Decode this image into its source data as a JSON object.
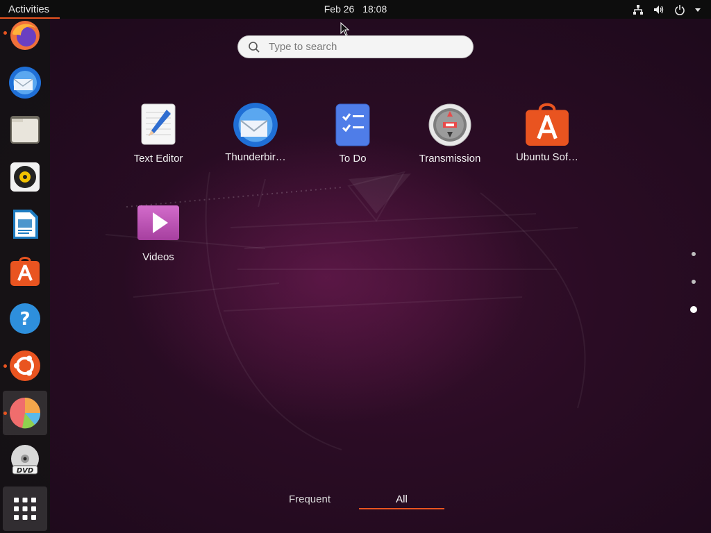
{
  "topbar": {
    "activities_label": "Activities",
    "date": "Feb 26",
    "time": "18:08",
    "tray_icons": [
      "network-icon",
      "volume-icon",
      "power-icon"
    ]
  },
  "search": {
    "placeholder": "Type to search",
    "value": ""
  },
  "dock": {
    "items": [
      {
        "name": "firefox",
        "running": true
      },
      {
        "name": "thunderbird",
        "running": false
      },
      {
        "name": "files",
        "running": false
      },
      {
        "name": "rhythmbox",
        "running": false
      },
      {
        "name": "libreoffice-writer",
        "running": false
      },
      {
        "name": "ubuntu-software",
        "running": false
      },
      {
        "name": "help",
        "running": false
      },
      {
        "name": "ubuntu",
        "running": true
      },
      {
        "name": "disk-usage-analyzer",
        "running": true,
        "focused": true
      },
      {
        "name": "dvd",
        "running": false
      },
      {
        "name": "show-applications",
        "running": false
      }
    ]
  },
  "apps": [
    {
      "label": "Text Editor",
      "icon": "text-editor-icon"
    },
    {
      "label": "Thunderbir…",
      "icon": "thunderbird-icon"
    },
    {
      "label": "To Do",
      "icon": "todo-icon"
    },
    {
      "label": "Transmission",
      "icon": "transmission-icon"
    },
    {
      "label": "Ubuntu Sof…",
      "icon": "ubuntu-software-icon"
    },
    {
      "label": "Videos",
      "icon": "videos-icon"
    }
  ],
  "page_indicator": {
    "pages": 3,
    "current": 3
  },
  "tabs": [
    {
      "label": "Frequent",
      "active": false
    },
    {
      "label": "All",
      "active": true
    }
  ],
  "colors": {
    "accent": "#e95420",
    "topbar": "#0d0d0d",
    "wallpaper": "#2c0d27"
  }
}
